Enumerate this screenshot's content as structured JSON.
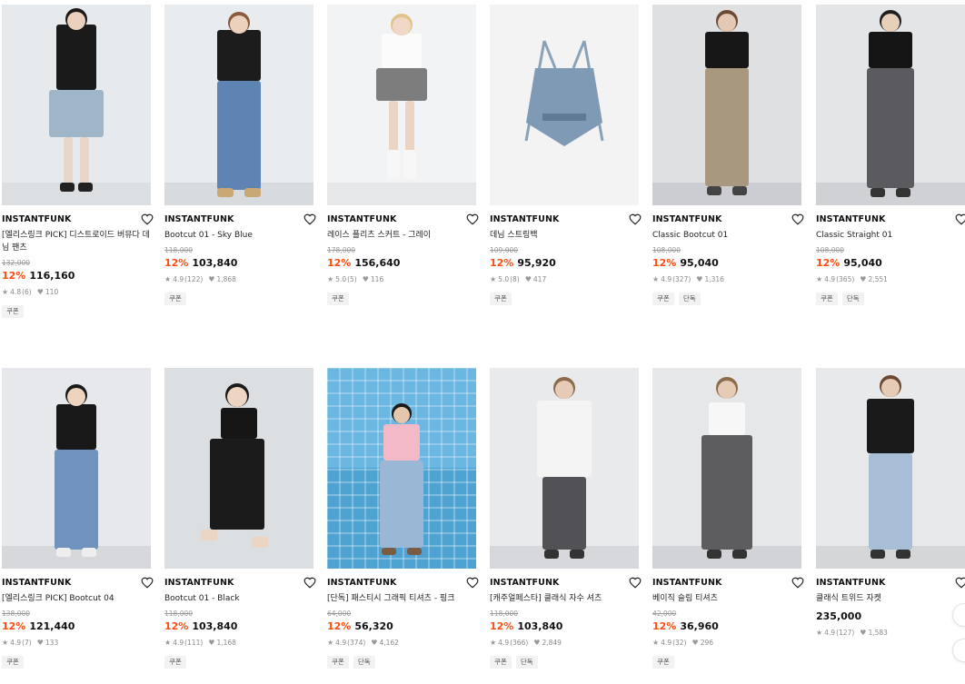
{
  "products": [
    {
      "brand": "INSTANTFUNK",
      "name": "[엘리스링크 PICK] 디스트로이드 버뮤다 데님 팬츠",
      "orig": "132,000",
      "disc": "12%",
      "price": "116,160",
      "rating": "4.8",
      "reviews": "(6)",
      "likes": "110",
      "badges": [
        "쿠폰"
      ]
    },
    {
      "brand": "INSTANTFUNK",
      "name": "Bootcut 01 - Sky Blue",
      "orig": "118,000",
      "disc": "12%",
      "price": "103,840",
      "rating": "4.9",
      "reviews": "(122)",
      "likes": "1,868",
      "badges": [
        "쿠폰"
      ]
    },
    {
      "brand": "INSTANTFUNK",
      "name": "레이스 플리츠 스커트 - 그레이",
      "orig": "178,000",
      "disc": "12%",
      "price": "156,640",
      "rating": "5.0",
      "reviews": "(5)",
      "likes": "116",
      "badges": [
        "쿠폰"
      ]
    },
    {
      "brand": "INSTANTFUNK",
      "name": "데님 스트링백",
      "orig": "109,000",
      "disc": "12%",
      "price": "95,920",
      "rating": "5.0",
      "reviews": "(8)",
      "likes": "417",
      "badges": [
        "쿠폰"
      ]
    },
    {
      "brand": "INSTANTFUNK",
      "name": "Classic Bootcut 01",
      "orig": "108,000",
      "disc": "12%",
      "price": "95,040",
      "rating": "4.9",
      "reviews": "(327)",
      "likes": "1,316",
      "badges": [
        "쿠폰",
        "단독"
      ]
    },
    {
      "brand": "INSTANTFUNK",
      "name": "Classic Straight 01",
      "orig": "108,000",
      "disc": "12%",
      "price": "95,040",
      "rating": "4.9",
      "reviews": "(365)",
      "likes": "2,551",
      "badges": [
        "쿠폰",
        "단독"
      ]
    },
    {
      "brand": "INSTANTFUNK",
      "name": "[엘리스링크 PICK] Bootcut 04",
      "orig": "138,000",
      "disc": "12%",
      "price": "121,440",
      "rating": "4.9",
      "reviews": "(7)",
      "likes": "133",
      "badges": [
        "쿠폰"
      ]
    },
    {
      "brand": "INSTANTFUNK",
      "name": "Bootcut 01 - Black",
      "orig": "118,000",
      "disc": "12%",
      "price": "103,840",
      "rating": "4.9",
      "reviews": "(111)",
      "likes": "1,168",
      "badges": [
        "쿠폰"
      ]
    },
    {
      "brand": "INSTANTFUNK",
      "name": "[단독] 패스티시 그래픽 티셔츠 - 핑크",
      "orig": "64,000",
      "disc": "12%",
      "price": "56,320",
      "rating": "4.9",
      "reviews": "(374)",
      "likes": "4,162",
      "badges": [
        "쿠폰",
        "단독"
      ]
    },
    {
      "brand": "INSTANTFUNK",
      "name": "[캐주얼페스타] 클래식 자수 셔츠",
      "orig": "118,000",
      "disc": "12%",
      "price": "103,840",
      "rating": "4.9",
      "reviews": "(366)",
      "likes": "2,849",
      "badges": [
        "쿠폰",
        "단독"
      ]
    },
    {
      "brand": "INSTANTFUNK",
      "name": "베이직 슬림 티셔츠",
      "orig": "42,000",
      "disc": "12%",
      "price": "36,960",
      "rating": "4.9",
      "reviews": "(32)",
      "likes": "296",
      "badges": [
        "쿠폰"
      ]
    },
    {
      "brand": "INSTANTFUNK",
      "name": "클래식 트위드 자켓",
      "orig": "",
      "disc": "",
      "price": "235,000",
      "rating": "4.9",
      "reviews": "(127)",
      "likes": "1,583",
      "badges": []
    }
  ],
  "colors": {
    "discount": "#ff4d12",
    "badge_bg": "#f2f2f2",
    "muted": "#9a9a9a"
  },
  "icons": {
    "wishlist": "heart-outline-icon",
    "rating": "star-icon",
    "likes": "heart-filled-icon"
  }
}
